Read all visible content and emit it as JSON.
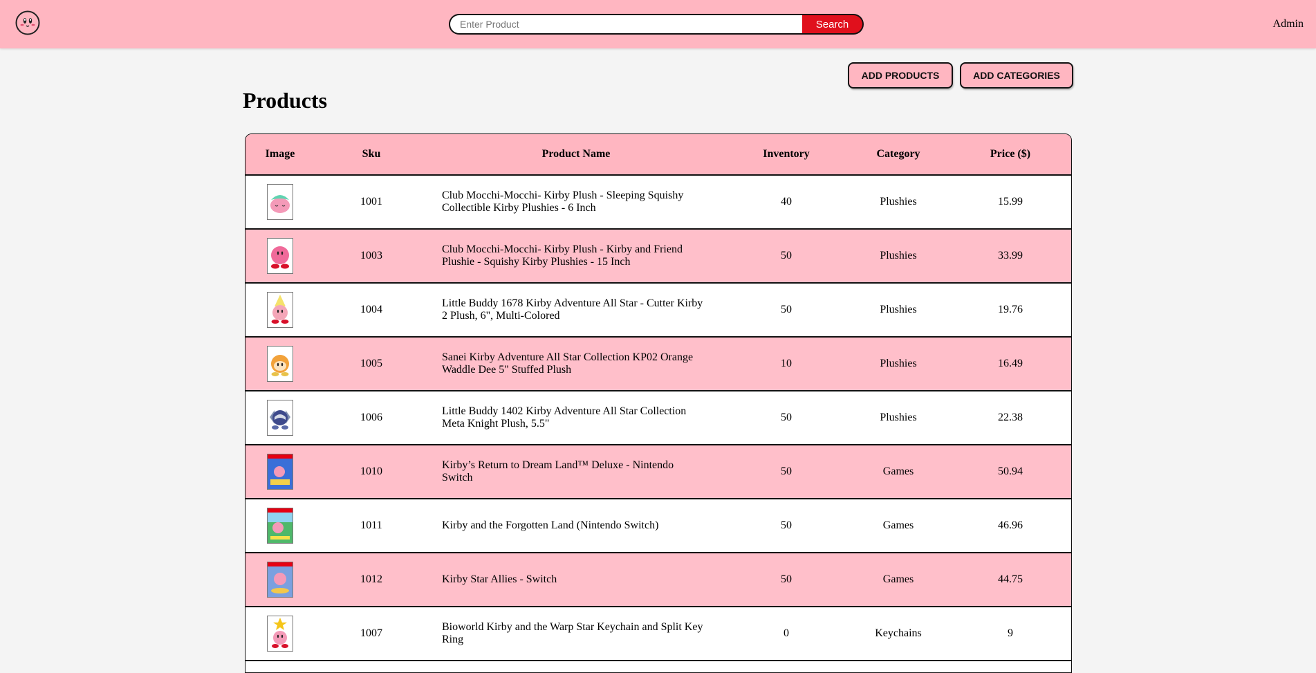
{
  "header": {
    "logo_icon": "kirby-face-icon",
    "search": {
      "placeholder": "Enter Product",
      "value": "",
      "button_label": "Search"
    },
    "user_label": "Admin",
    "colors": {
      "bar": "#ffb6c1",
      "search_button": "#e0101c"
    }
  },
  "actions": {
    "add_products": "ADD PRODUCTS",
    "add_categories": "ADD CATEGORIES"
  },
  "page_title": "Products",
  "table": {
    "columns": [
      "Image",
      "Sku",
      "Product Name",
      "Inventory",
      "Category",
      "Price ($)"
    ],
    "rows": [
      {
        "image": "sleeping-kirby-plush-thumbnail",
        "sku": "1001",
        "name": "Club Mocchi-Mocchi- Kirby Plush - Sleeping Squishy Collectible Kirby Plushies - 6 Inch",
        "inventory": "40",
        "category": "Plushies",
        "price": "15.99"
      },
      {
        "image": "kirby-plushie-thumbnail",
        "sku": "1003",
        "name": "Club Mocchi-Mocchi- Kirby Plush - Kirby and Friend Plushie - Squishy Kirby Plushies - 15 Inch",
        "inventory": "50",
        "category": "Plushies",
        "price": "33.99"
      },
      {
        "image": "cutter-kirby-plush-thumbnail",
        "sku": "1004",
        "name": "Little Buddy 1678 Kirby Adventure All Star - Cutter Kirby 2 Plush, 6\", Multi-Colored",
        "inventory": "50",
        "category": "Plushies",
        "price": "19.76"
      },
      {
        "image": "waddle-dee-plush-thumbnail",
        "sku": "1005",
        "name": "Sanei Kirby Adventure All Star Collection KP02 Orange Waddle Dee 5\" Stuffed Plush",
        "inventory": "10",
        "category": "Plushies",
        "price": "16.49"
      },
      {
        "image": "meta-knight-plush-thumbnail",
        "sku": "1006",
        "name": "Little Buddy 1402 Kirby Adventure All Star Collection Meta Knight Plush, 5.5\"",
        "inventory": "50",
        "category": "Plushies",
        "price": "22.38"
      },
      {
        "image": "return-to-dreamland-box-thumbnail",
        "sku": "1010",
        "name": "Kirby’s Return to Dream Land™ Deluxe - Nintendo Switch",
        "inventory": "50",
        "category": "Games",
        "price": "50.94"
      },
      {
        "image": "forgotten-land-box-thumbnail",
        "sku": "1011",
        "name": "Kirby and the Forgotten Land (Nintendo Switch)",
        "inventory": "50",
        "category": "Games",
        "price": "46.96"
      },
      {
        "image": "star-allies-box-thumbnail",
        "sku": "1012",
        "name": "Kirby Star Allies - Switch",
        "inventory": "50",
        "category": "Games",
        "price": "44.75"
      },
      {
        "image": "warp-star-keychain-thumbnail",
        "sku": "1007",
        "name": "Bioworld Kirby and the Warp Star Keychain and Split Key Ring",
        "inventory": "0",
        "category": "Keychains",
        "price": "9"
      }
    ]
  }
}
